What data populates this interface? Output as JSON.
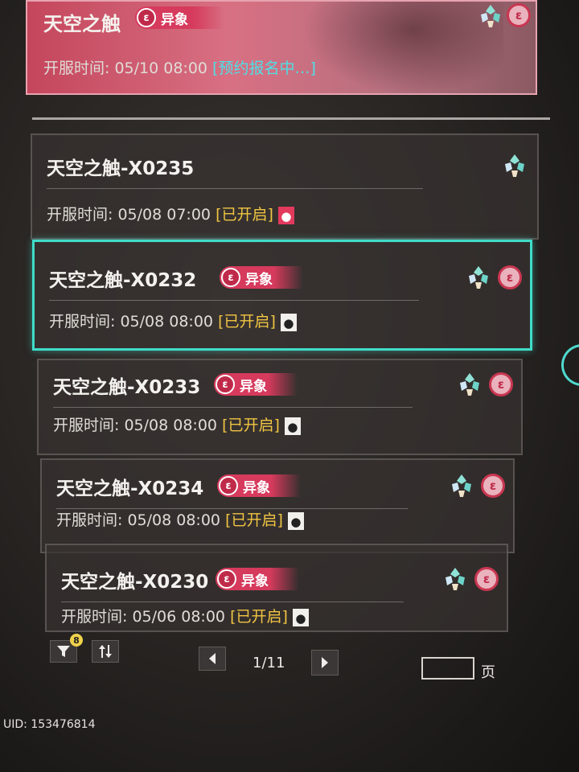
{
  "colors": {
    "selection": "#3fdcc8",
    "tag_bg": "#d63a5c",
    "status_yellow": "#f1c542",
    "status_cyan": "#4fe0e6",
    "featured_bg": "#c4465c"
  },
  "featured": {
    "name": "天空之触",
    "tag": "异象",
    "time_label": "开服时间:",
    "time": "05/10 08:00",
    "status": "[预约报名中…]",
    "icons": [
      "crystal-icon",
      "anomaly-icon"
    ]
  },
  "servers": [
    {
      "name": "天空之触-X0235",
      "tag": "",
      "time_label": "开服时间:",
      "time": "05/08 07:00",
      "status": "[已开启]",
      "person_icon": "new-player-icon-red",
      "icons": [
        "crystal-icon"
      ],
      "selected": false
    },
    {
      "name": "天空之触-X0232",
      "tag": "异象",
      "time_label": "开服时间:",
      "time": "05/08 08:00",
      "status": "[已开启]",
      "person_icon": "player-icon",
      "icons": [
        "crystal-icon",
        "anomaly-icon"
      ],
      "selected": true
    },
    {
      "name": "天空之触-X0233",
      "tag": "异象",
      "time_label": "开服时间:",
      "time": "05/08 08:00",
      "status": "[已开启]",
      "person_icon": "player-icon",
      "icons": [
        "crystal-icon",
        "anomaly-icon"
      ],
      "selected": false
    },
    {
      "name": "天空之触-X0234",
      "tag": "异象",
      "time_label": "开服时间:",
      "time": "05/08 08:00",
      "status": "[已开启]",
      "person_icon": "player-icon",
      "icons": [
        "crystal-icon",
        "anomaly-icon"
      ],
      "selected": false
    },
    {
      "name": "天空之触-X0230",
      "tag": "异象",
      "time_label": "开服时间:",
      "time": "05/06 08:00",
      "status": "[已开启]",
      "person_icon": "player-icon",
      "icons": [
        "crystal-icon",
        "anomaly-icon"
      ],
      "selected": false
    }
  ],
  "toolbar": {
    "filter_icon": "filter-icon",
    "filter_badge": "8",
    "sort_icon": "sort-icon",
    "prev_icon": "chevron-left-icon",
    "next_icon": "chevron-right-icon",
    "page": "1/11",
    "page_input_value": "",
    "page_suffix": "页"
  },
  "footer": {
    "uid": "UID: 153476814"
  }
}
